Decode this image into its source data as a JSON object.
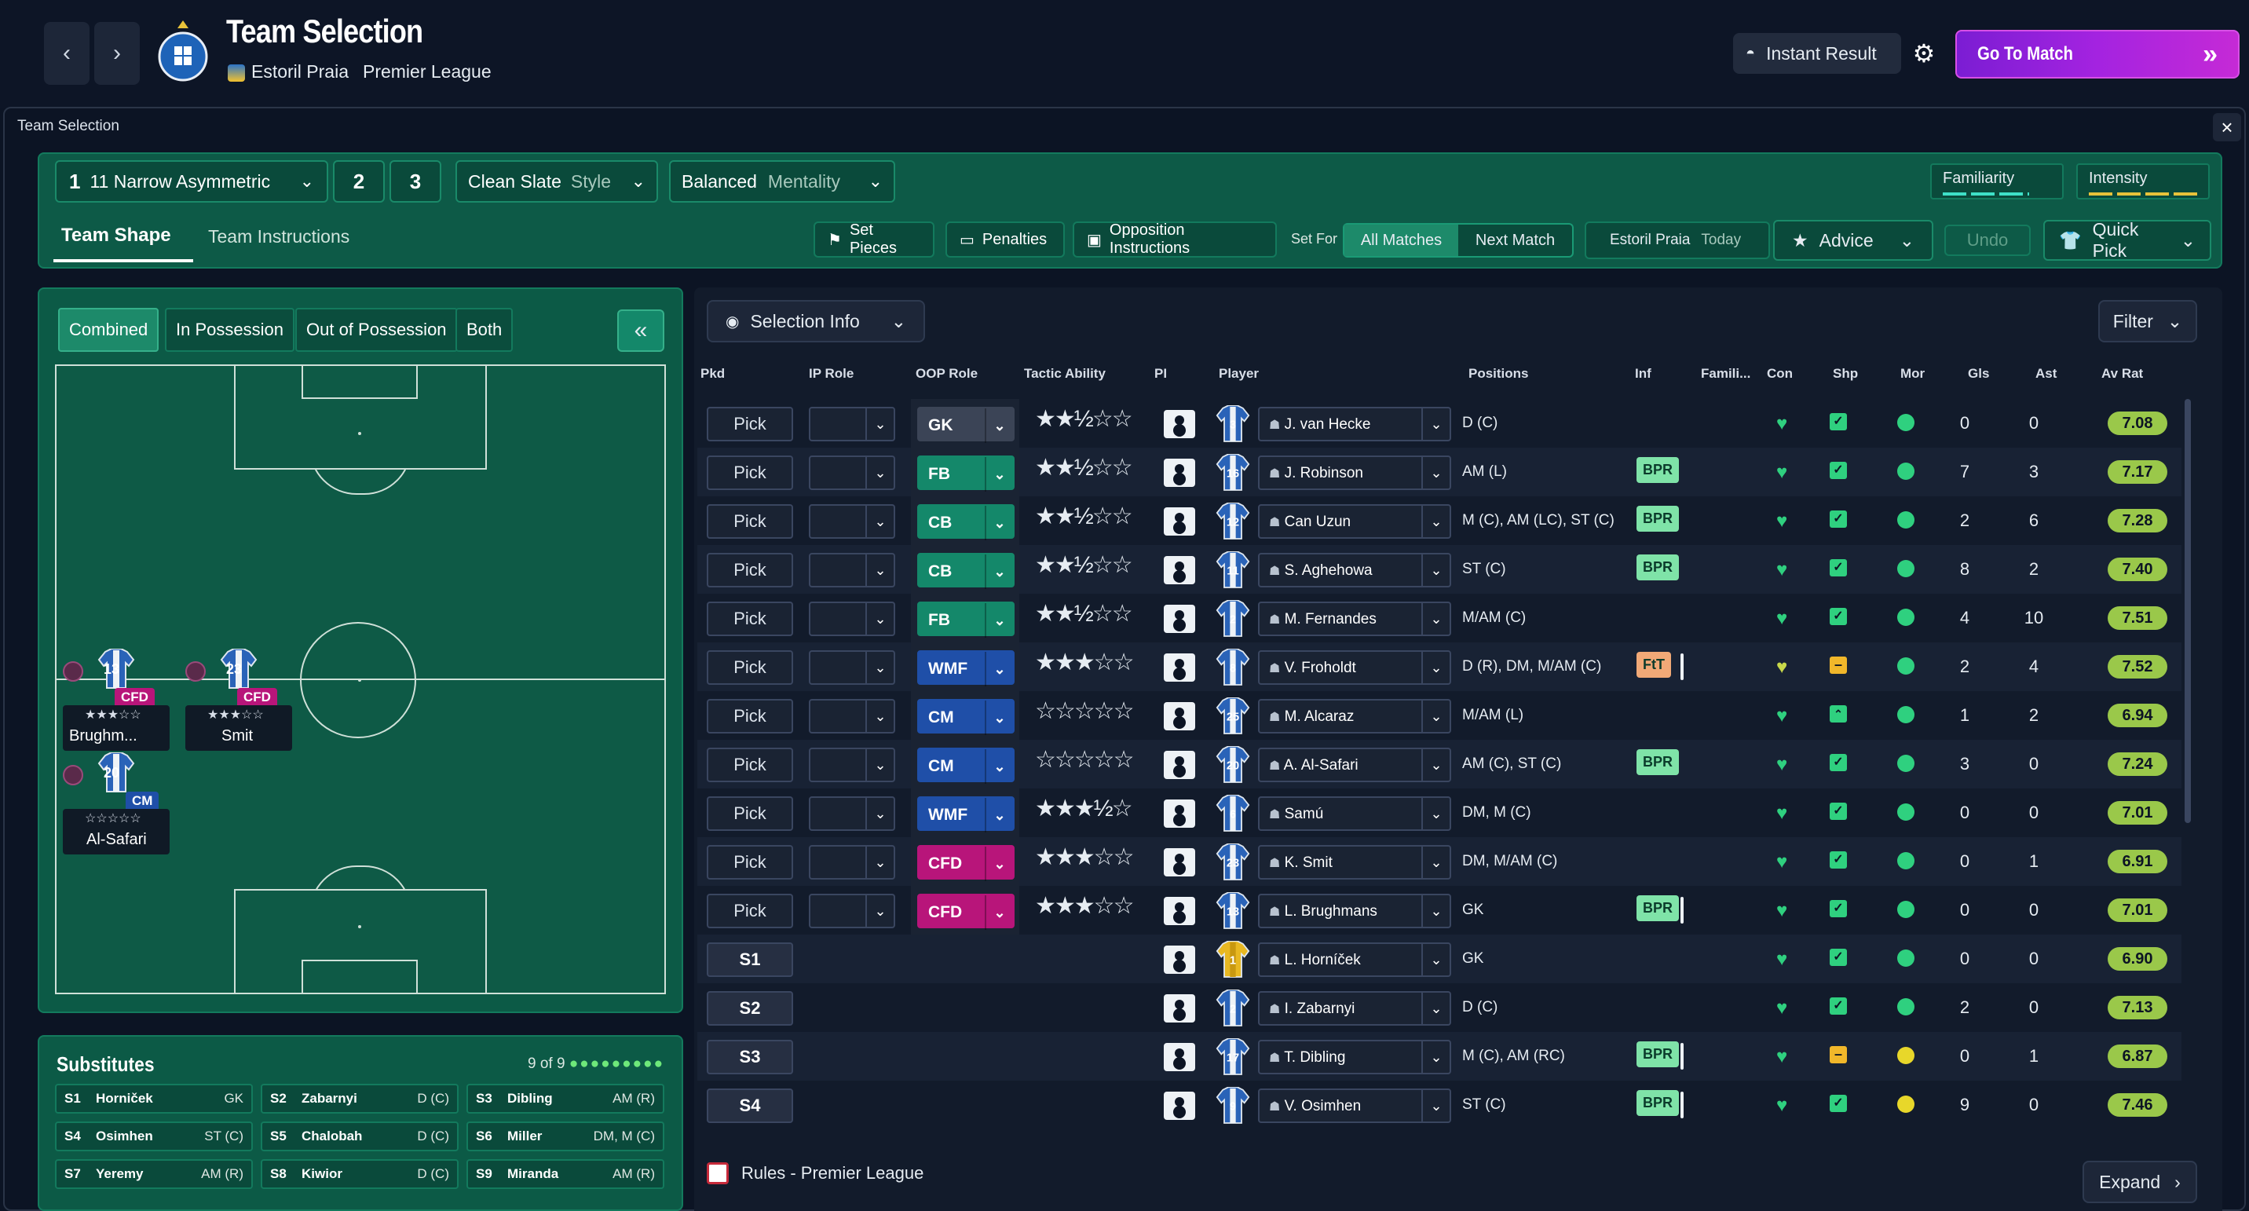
{
  "header": {
    "title": "Team Selection",
    "club_name": "Estoril Praia",
    "competition": "Premier League",
    "instant_result": "Instant Result",
    "go_to_match": "Go To Match"
  },
  "panel": {
    "title": "Team Selection"
  },
  "tactics": {
    "slot1_num": "1",
    "slot1_name": "11 Narrow Asymmetric",
    "slot2": "2",
    "slot3": "3",
    "style_value": "Clean Slate",
    "style_label": "Style",
    "mentality_value": "Balanced",
    "mentality_label": "Mentality",
    "familiarity": "Familiarity",
    "intensity": "Intensity"
  },
  "tabs": {
    "team_shape": "Team Shape",
    "team_instructions": "Team Instructions",
    "set_pieces": "Set Pieces",
    "penalties": "Penalties",
    "opposition": "Opposition Instructions",
    "set_for": "Set For",
    "all_matches": "All Matches",
    "next_match": "Next Match",
    "club": "Estoril Praia",
    "today": "Today",
    "advice": "Advice",
    "undo": "Undo",
    "quick_pick": "Quick Pick"
  },
  "pitch_tabs": [
    "Combined",
    "In Possession",
    "Out of Possession",
    "Both"
  ],
  "pitch_players": [
    {
      "num": "13",
      "role": "CFD",
      "stars": "★★★☆☆",
      "name": "Brughm...",
      "role_color": "#b8157a"
    },
    {
      "num": "23",
      "role": "CFD",
      "stars": "★★★☆☆",
      "name": "Smit",
      "role_color": "#b8157a"
    },
    {
      "num": "20",
      "role": "CM",
      "stars": "☆☆☆☆☆",
      "name": "Al-Safari",
      "role_color": "#1f4fa8"
    }
  ],
  "subs": {
    "title": "Substitutes",
    "count": "9 of 9",
    "items": [
      {
        "id": "S1",
        "name": "Horniček",
        "pos": "GK"
      },
      {
        "id": "S2",
        "name": "Zabarnyi",
        "pos": "D (C)"
      },
      {
        "id": "S3",
        "name": "Dibling",
        "pos": "AM (R)"
      },
      {
        "id": "S4",
        "name": "Osimhen",
        "pos": "ST (C)"
      },
      {
        "id": "S5",
        "name": "Chalobah",
        "pos": "D (C)"
      },
      {
        "id": "S6",
        "name": "Miller",
        "pos": "DM, M (C)"
      },
      {
        "id": "S7",
        "name": "Yeremy",
        "pos": "AM (R)"
      },
      {
        "id": "S8",
        "name": "Kiwior",
        "pos": "D (C)"
      },
      {
        "id": "S9",
        "name": "Miranda",
        "pos": "AM (R)"
      }
    ]
  },
  "table": {
    "selection_info": "Selection Info",
    "filter": "Filter",
    "columns": [
      "Pkd",
      "IP Role",
      "OOP Role",
      "Tactic Ability",
      "PI",
      "Player",
      "Positions",
      "Inf",
      "Famili...",
      "Con",
      "Shp",
      "Mor",
      "Gls",
      "Ast",
      "Av Rat"
    ],
    "pick_label": "Pick",
    "rows": [
      {
        "pkd": "Pick",
        "oop": "GK",
        "oop_color": "#3b4456",
        "ta": "★★½☆☆",
        "kit": "3",
        "player": "J. van Hecke",
        "positions": "D (C)",
        "inf": "",
        "shp": "tick",
        "mor": "good",
        "gls": "0",
        "ast": "0",
        "rat": "7.08"
      },
      {
        "pkd": "Pick",
        "oop": "FB",
        "oop_color": "#14886a",
        "ta": "★★½☆☆",
        "kit": "16",
        "player": "J. Robinson",
        "positions": "AM (L)",
        "inf": "BPR",
        "shp": "tick",
        "mor": "good",
        "gls": "7",
        "ast": "3",
        "rat": "7.17"
      },
      {
        "pkd": "Pick",
        "oop": "CB",
        "oop_color": "#14886a",
        "ta": "★★½☆☆",
        "kit": "12",
        "player": "Can Uzun",
        "positions": "M (C), AM (LC), ST (C)",
        "inf": "BPR",
        "shp": "tick",
        "mor": "good",
        "gls": "2",
        "ast": "6",
        "rat": "7.28"
      },
      {
        "pkd": "Pick",
        "oop": "CB",
        "oop_color": "#14886a",
        "ta": "★★½☆☆",
        "kit": "11",
        "player": "S. Aghehowa",
        "positions": "ST (C)",
        "inf": "BPR",
        "shp": "tick",
        "mor": "good",
        "gls": "8",
        "ast": "2",
        "rat": "7.40"
      },
      {
        "pkd": "Pick",
        "oop": "FB",
        "oop_color": "#14886a",
        "ta": "★★½☆☆",
        "kit": "2",
        "player": "M. Fernandes",
        "positions": "M/AM (C)",
        "inf": "",
        "shp": "tick",
        "mor": "good",
        "gls": "4",
        "ast": "10",
        "rat": "7.51"
      },
      {
        "pkd": "Pick",
        "oop": "WMF",
        "oop_color": "#1f4fa8",
        "ta": "★★★☆☆",
        "kit": "8",
        "player": "V. Froholdt",
        "positions": "D (R), DM, M/AM (C)",
        "inf": "FtT",
        "shp": "dash",
        "mor": "good",
        "gls": "2",
        "ast": "4",
        "rat": "7.52"
      },
      {
        "pkd": "Pick",
        "oop": "CM",
        "oop_color": "#1f4fa8",
        "ta": "☆☆☆☆☆",
        "kit": "25",
        "player": "M. Alcaraz",
        "positions": "M/AM (L)",
        "inf": "",
        "shp": "up",
        "mor": "good",
        "gls": "1",
        "ast": "2",
        "rat": "6.94"
      },
      {
        "pkd": "Pick",
        "oop": "CM",
        "oop_color": "#1f4fa8",
        "ta": "☆☆☆☆☆",
        "kit": "20",
        "player": "A. Al-Safari",
        "positions": "AM (C), ST (C)",
        "inf": "BPR",
        "shp": "tick",
        "mor": "good",
        "gls": "3",
        "ast": "0",
        "rat": "7.24"
      },
      {
        "pkd": "Pick",
        "oop": "WMF",
        "oop_color": "#1f4fa8",
        "ta": "★★★½☆",
        "kit": "6",
        "player": "Samú",
        "positions": "DM, M (C)",
        "inf": "",
        "shp": "tick",
        "mor": "good",
        "gls": "0",
        "ast": "0",
        "rat": "7.01"
      },
      {
        "pkd": "Pick",
        "oop": "CFD",
        "oop_color": "#b8157a",
        "ta": "★★★☆☆",
        "kit": "23",
        "player": "K. Smit",
        "positions": "DM, M/AM (C)",
        "inf": "",
        "shp": "tick",
        "mor": "good",
        "gls": "0",
        "ast": "1",
        "rat": "6.91"
      },
      {
        "pkd": "Pick",
        "oop": "CFD",
        "oop_color": "#b8157a",
        "ta": "★★★☆☆",
        "kit": "13",
        "player": "L. Brughmans",
        "positions": "GK",
        "inf": "BPR",
        "shp": "tick",
        "mor": "good",
        "gls": "0",
        "ast": "0",
        "rat": "7.01"
      },
      {
        "pkd": "S1",
        "oop": "",
        "oop_color": "",
        "ta": "",
        "kit": "1",
        "player": "L. Horníček",
        "positions": "GK",
        "inf": "",
        "shp": "tick",
        "mor": "good",
        "gls": "0",
        "ast": "0",
        "rat": "6.90"
      },
      {
        "pkd": "S2",
        "oop": "",
        "oop_color": "",
        "ta": "",
        "kit": "2",
        "player": "I. Zabarnyi",
        "positions": "D (C)",
        "inf": "",
        "shp": "tick",
        "mor": "good",
        "gls": "2",
        "ast": "0",
        "rat": "7.13"
      },
      {
        "pkd": "S3",
        "oop": "",
        "oop_color": "",
        "ta": "",
        "kit": "17",
        "player": "T. Dibling",
        "positions": "M (C), AM (RC)",
        "inf": "BPR",
        "shp": "dash",
        "mor": "ok",
        "gls": "0",
        "ast": "1",
        "rat": "6.87"
      },
      {
        "pkd": "S4",
        "oop": "",
        "oop_color": "",
        "ta": "",
        "kit": "9",
        "player": "V. Osimhen",
        "positions": "ST (C)",
        "inf": "BPR",
        "shp": "tick",
        "mor": "ok",
        "gls": "9",
        "ast": "0",
        "rat": "7.46"
      }
    ]
  },
  "footer": {
    "rules": "Rules - Premier League",
    "expand": "Expand"
  },
  "colors": {
    "accent_green": "#0d5a47",
    "go_to_match": "#a423e0",
    "rating": "#9ac84a",
    "bpr": "#7fe3a8",
    "ftt": "#f1a977"
  }
}
